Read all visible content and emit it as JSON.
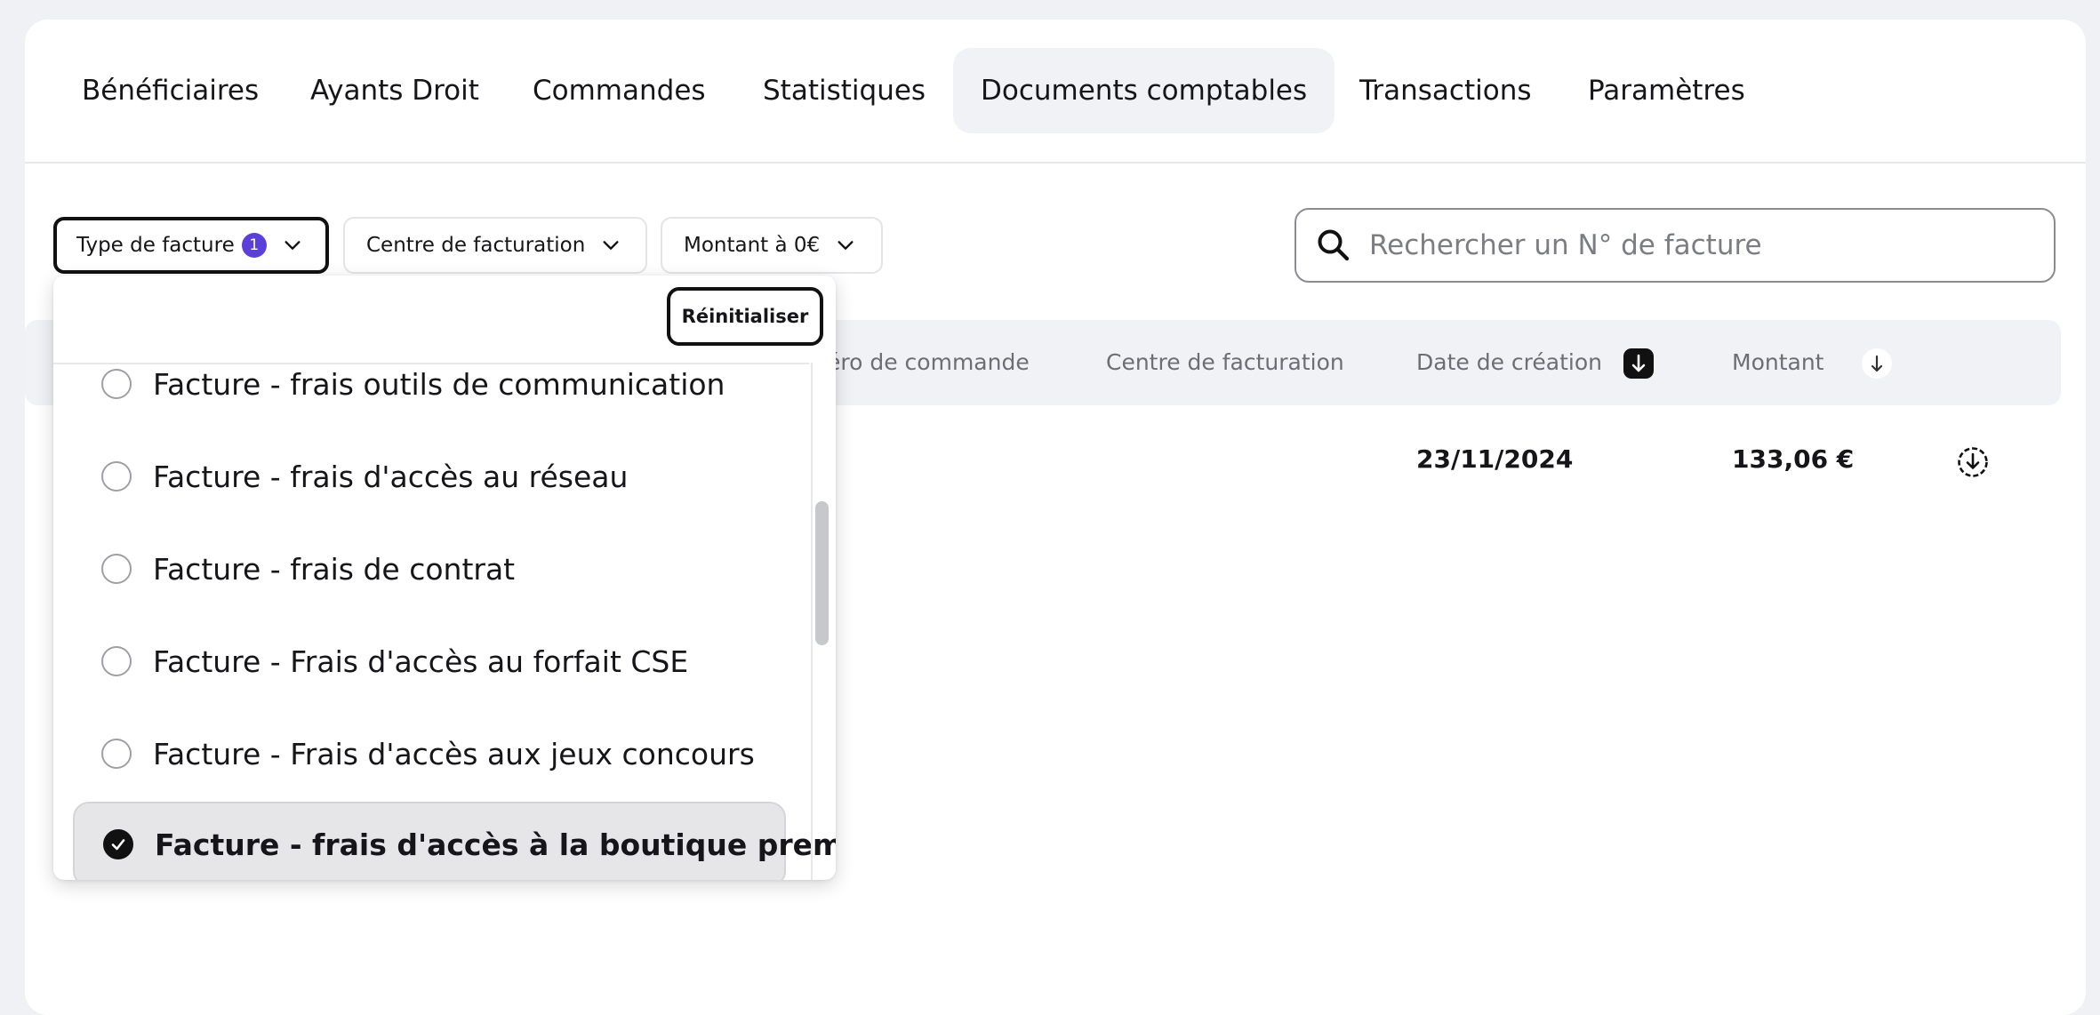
{
  "tabs": [
    {
      "label": "Bénéficiaires"
    },
    {
      "label": "Ayants Droit"
    },
    {
      "label": "Commandes"
    },
    {
      "label": "Statistiques"
    },
    {
      "label": "Documents comptables",
      "active": true
    },
    {
      "label": "Transactions"
    },
    {
      "label": "Paramètres"
    }
  ],
  "filters": {
    "invoice_type": {
      "label": "Type de facture",
      "count": "1"
    },
    "billing_center": {
      "label": "Centre de facturation"
    },
    "zero_amount": {
      "label": "Montant à 0€"
    }
  },
  "search": {
    "placeholder": "Rechercher un N° de facture",
    "icon": "search-icon"
  },
  "table": {
    "headers": {
      "order_number": "éro de commande",
      "billing_center": "Centre de facturation",
      "creation_date": "Date de création",
      "amount": "Montant"
    },
    "rows": [
      {
        "creation_date": "23/11/2024",
        "amount": "133,06 €",
        "action_icon": "download-icon"
      }
    ]
  },
  "dropdown": {
    "reset_label": "Réinitialiser",
    "options": [
      {
        "label": "Facture - frais outils de communication",
        "checked": false
      },
      {
        "label": "Facture - frais d'accès au réseau",
        "checked": false
      },
      {
        "label": "Facture - frais de contrat",
        "checked": false
      },
      {
        "label": "Facture - Frais d'accès au forfait CSE",
        "checked": false
      },
      {
        "label": "Facture - Frais d'accès aux jeux concours",
        "checked": false
      },
      {
        "label": "Facture - frais d'accès à la boutique premium",
        "checked": true
      }
    ]
  },
  "colors": {
    "accent": "#5a3fd9",
    "background": "#eff1f5",
    "active_tab": "#f0f2f6"
  }
}
